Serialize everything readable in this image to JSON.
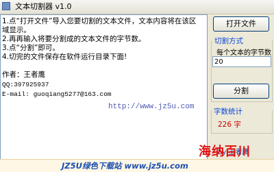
{
  "window": {
    "title": "文本切割器 v1.0"
  },
  "text_area": {
    "lines": [
      "1.点“打开文件”导入您要切割的文本文件，文本内容将在该区",
      "域显示。",
      "2.再再输入将要分割成的文本文件的字节数。",
      "3.点“分割”即可。",
      "4.切完的文件保存在软件运行目录下面!",
      "",
      "作者：王者鹰",
      "QQ:397925937",
      "E-mail: guoqiang5277@163.com"
    ],
    "url": "http://www.jz5u.com"
  },
  "right_panel": {
    "open_button": "打开文件",
    "split_group": "切割方式",
    "bytes_prompt": "每个文本的字节数",
    "bytes_value": "20",
    "split_button": "分割",
    "stats_group": "字数统计",
    "char_count": "226 字",
    "author": "by 王者鹰"
  },
  "watermark": {
    "main": "海纳百川",
    "site": "JZ5U绿色下载站 www.jz5u.com"
  }
}
